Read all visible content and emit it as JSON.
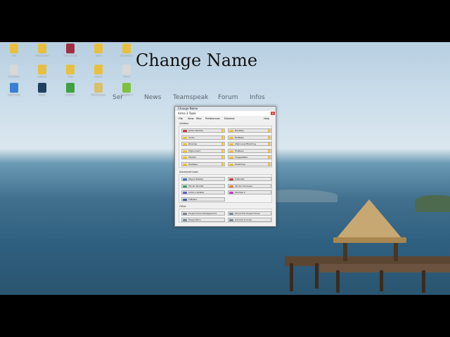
{
  "overlay": {
    "title": "Change Name"
  },
  "website_nav": [
    "Ser",
    "News",
    "Teamspeak",
    "Forum",
    "Infos"
  ],
  "desktop_icons_left": [
    {
      "label": "Aria",
      "color": "#e8c040"
    },
    {
      "label": "Arma Bridge",
      "color": "#e8c040"
    },
    {
      "label": "Arma 3 Tools",
      "color": "#a03040"
    },
    {
      "label": "cover",
      "color": "#e8c040"
    },
    {
      "label": "Documents",
      "color": "#e8c040"
    },
    {
      "label": "Papierkorb",
      "color": "#d8d8d8"
    },
    {
      "label": "backend",
      "color": "#e8c040"
    },
    {
      "label": "tools",
      "color": "#e8c040"
    },
    {
      "label": "Addons",
      "color": "#e8c040"
    },
    {
      "label": "Player",
      "color": "#d8d8d8"
    },
    {
      "label": "TeamViewer",
      "color": "#3a80d0"
    },
    {
      "label": "Steam",
      "color": "#204060"
    },
    {
      "label": "CCleaner",
      "color": "#40a040"
    },
    {
      "label": "PBO Manager",
      "color": "#d8c070"
    },
    {
      "label": "Notepad++",
      "color": "#80c040"
    }
  ],
  "tools_window": {
    "outer_title": "Change Name",
    "title": "Arma 3 Tools",
    "close": "x",
    "menu": [
      "File",
      "View",
      "Misc",
      "Preferences",
      "External"
    ],
    "help": "Help",
    "utilities_label": "Utilities",
    "utilities": [
      {
        "label": "Addon Builder",
        "color": "#c04040",
        "warn": true
      },
      {
        "label": "BankRev",
        "color": "#e8c040",
        "warn": true
      },
      {
        "label": "Audio",
        "color": "#e8c040",
        "warn": true
      },
      {
        "label": "BinMake",
        "color": "#e8c040",
        "warn": true
      },
      {
        "label": "Binarize",
        "color": "#e8c040",
        "warn": true
      },
      {
        "label": "CfgConvertFileChng",
        "color": "#e8c040",
        "warn": true
      },
      {
        "label": "CfgConvert",
        "color": "#e8c040",
        "warn": true
      },
      {
        "label": "FileBank",
        "color": "#e8c040",
        "warn": true
      },
      {
        "label": "DSUtils",
        "color": "#e8c040",
        "warn": true
      },
      {
        "label": "ImageToPAA",
        "color": "#e8c040",
        "warn": true
      },
      {
        "label": "FileMake",
        "color": "#e8c040",
        "warn": true
      },
      {
        "label": "PAAToTGA",
        "color": "#e8c040",
        "warn": true
      }
    ],
    "advanced_label": "Advanced tools",
    "advanced": [
      {
        "label": "Object Builder",
        "color": "#4070c0"
      },
      {
        "label": "Publisher",
        "color": "#c04040"
      },
      {
        "label": "Terrain Builder",
        "color": "#40a060"
      },
      {
        "label": "Terrain Processor",
        "color": "#e08040"
      },
      {
        "label": "Addon Updater",
        "color": "#6060c0"
      },
      {
        "label": "TexView 2",
        "color": "#c040c0"
      },
      {
        "label": "FXEditor",
        "color": "#4060a0"
      }
    ],
    "other_label": "Other",
    "other": [
      "Project Drive Management",
      "Mount the Project Drive",
      "Diagnostics",
      "General License"
    ]
  }
}
